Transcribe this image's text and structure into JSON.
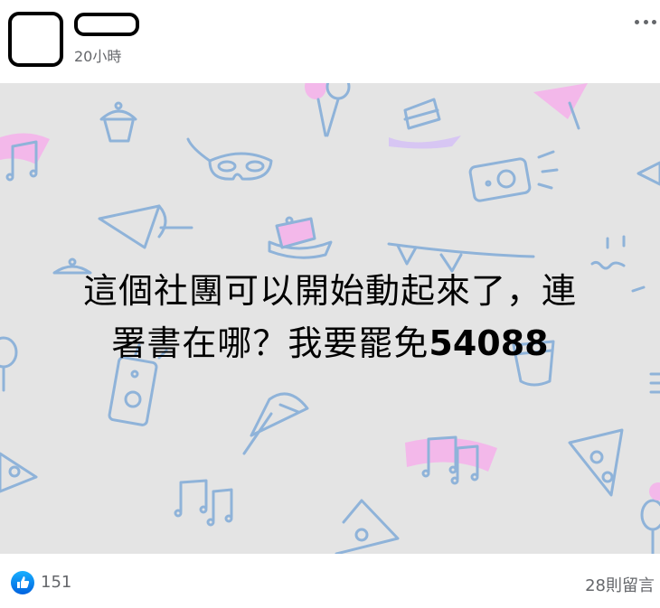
{
  "post": {
    "timestamp": "20小時",
    "text_line1": "這個社團可以開始動起來了，連",
    "text_line2_prefix": "署書在哪？我要罷免",
    "text_line2_number": "54088"
  },
  "footer": {
    "like_count": "151",
    "comment_count": "28則留言"
  },
  "colors": {
    "image_background": "#e4e4e4",
    "pattern_blue": "#8fb3d9",
    "pattern_pink": "#f5a3e8",
    "meta_text": "#65676b",
    "like_blue": "#1877f2"
  },
  "icons": [
    "avatar-placeholder",
    "more-options-icon",
    "like-thumb-icon"
  ]
}
